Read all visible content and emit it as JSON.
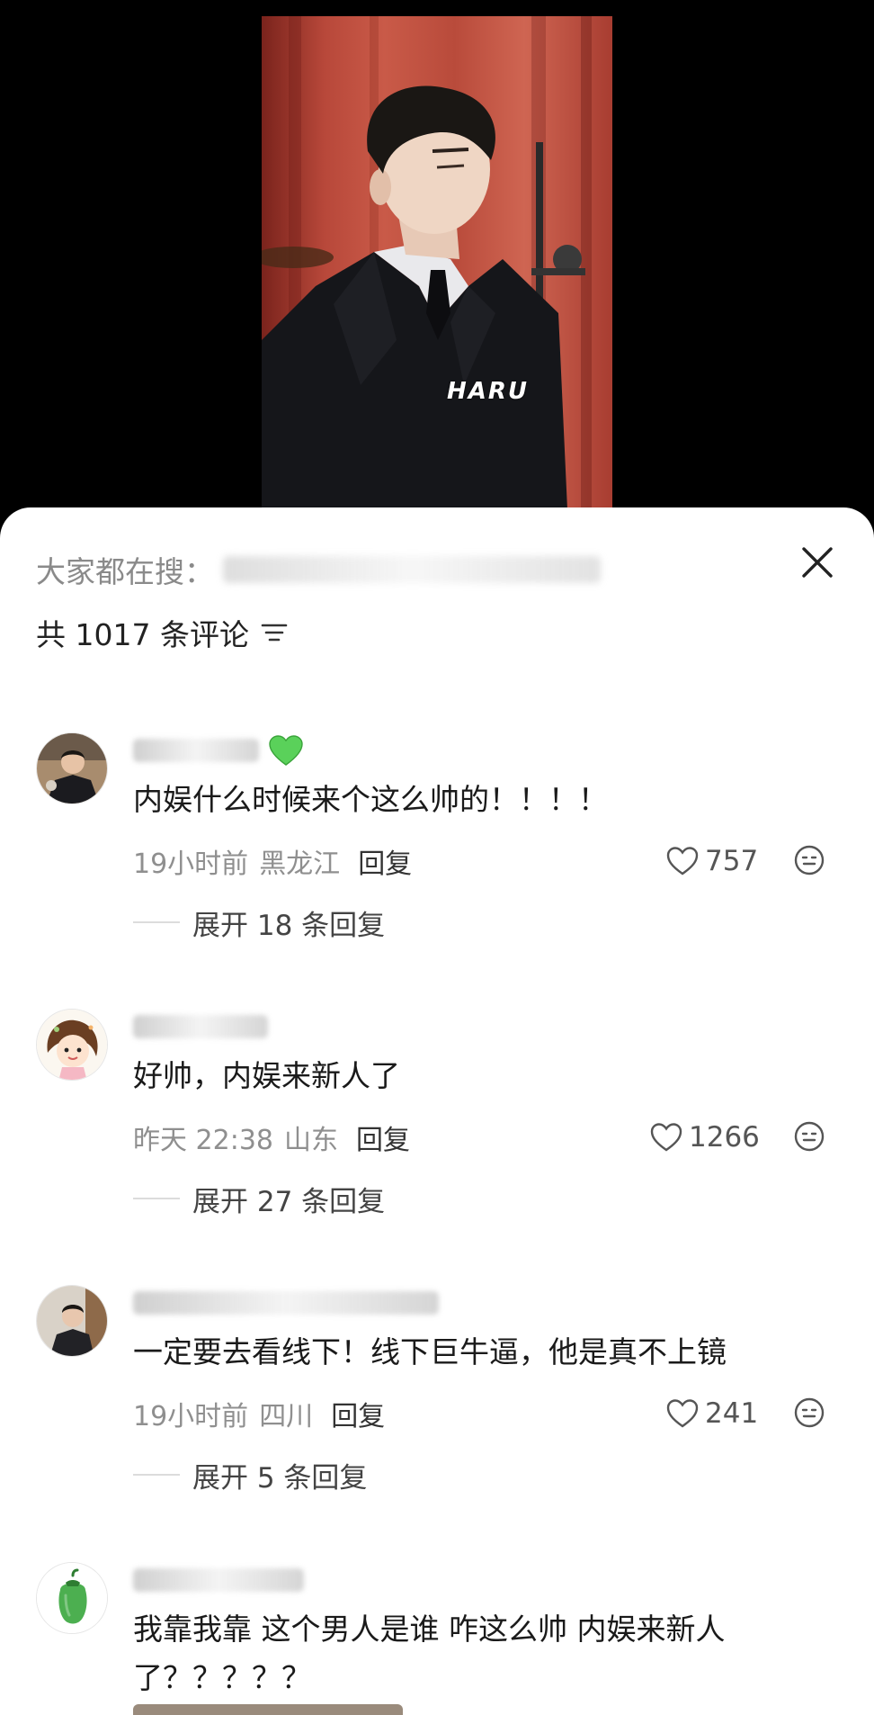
{
  "video": {
    "watermark": "HARU"
  },
  "header": {
    "search_label": "大家都在搜：",
    "comment_count_label": "共 1017 条评论"
  },
  "comments": [
    {
      "text": "内娱什么时候来个这么帅的！！！！",
      "time": "19小时前",
      "location": "黑龙江",
      "reply_label": "回复",
      "likes": "757",
      "expand_label": "展开 18 条回复"
    },
    {
      "text": "好帅，内娱来新人了",
      "time": "昨天 22:38",
      "location": "山东",
      "reply_label": "回复",
      "likes": "1266",
      "expand_label": "展开 27 条回复"
    },
    {
      "text": "一定要去看线下！线下巨牛逼，他是真不上镜",
      "time": "19小时前",
      "location": "四川",
      "reply_label": "回复",
      "likes": "241",
      "expand_label": "展开 5 条回复"
    },
    {
      "text": "我靠我靠 这个男人是谁 咋这么帅 内娱来新人了？？？？？"
    }
  ],
  "colors": {
    "sheet_bg": "#ffffff",
    "secondary_text": "#8f8f8f",
    "primary_text": "#1a1a1a",
    "green_heart": "#5ad15a"
  },
  "icons": [
    "close-icon",
    "sort-icon",
    "heart-outline-icon",
    "emoji-icon",
    "green-heart-emoji",
    "pepper-avatar"
  ]
}
